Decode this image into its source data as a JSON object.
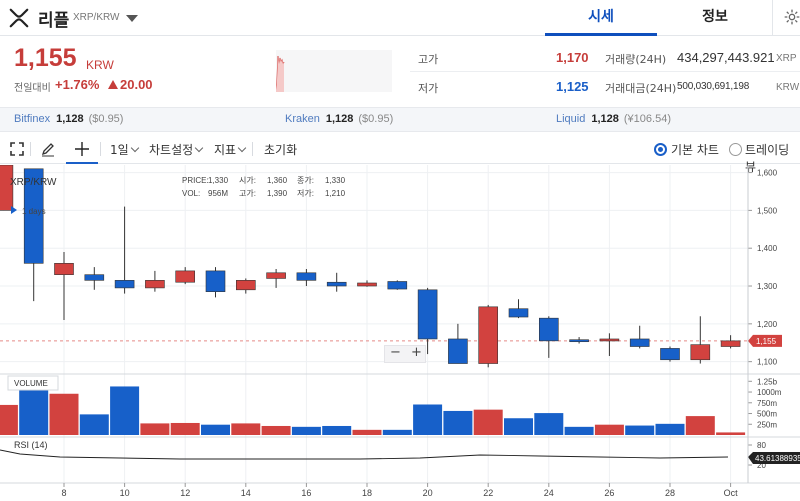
{
  "header": {
    "coin_name": "리플",
    "pair": "XRP/KRW",
    "tabs": [
      {
        "label": "시세",
        "active": true
      },
      {
        "label": "정보",
        "active": false
      }
    ]
  },
  "ticker": {
    "price": "1,155",
    "unit": "KRW",
    "change_label": "전일대비",
    "change_rate": "+1.76%",
    "change_amount": "20.00",
    "high_label": "고가",
    "high": "1,170",
    "low_label": "저가",
    "low": "1,125",
    "volume_label": "거래량(24H)",
    "volume": "434,297,443.921",
    "volume_unit": "XRP",
    "amount_label": "거래대금(24H)",
    "amount": "500,030,691,198",
    "amount_unit": "KRW"
  },
  "exchanges": [
    {
      "name": "Bitfinex",
      "price": "1,128",
      "diff": "($0.95)"
    },
    {
      "name": "Kraken",
      "price": "1,128",
      "diff": "($0.95)"
    },
    {
      "name": "Liquid",
      "price": "1,128",
      "diff": "(¥106.54)"
    }
  ],
  "toolbar": {
    "interval": "1일",
    "chart_settings": "차트설정",
    "indicators": "지표",
    "reset": "초기화",
    "basic_chart": "기본 차트",
    "tradingview": "트레이딩뷰"
  },
  "colors": {
    "up": "#d2423f",
    "down": "#1760c9",
    "accent": "#0f4fbd"
  },
  "chart_data": {
    "type": "candlestick",
    "title": "XRP/KRW",
    "interval_tag": "1 days",
    "ohlc_info": {
      "price_label": "PRICE:",
      "price": "1,330",
      "open_label": "시가:",
      "open": "1,360",
      "close_label": "종가:",
      "close": "1,330",
      "vol_label": "VOL:",
      "vol": "956M",
      "high_label": "고가:",
      "high": "1,390",
      "low_label": "저가:",
      "low": "1,210"
    },
    "price_axis": {
      "min": 1070,
      "max": 1620,
      "ticks": [
        "1,600",
        "1,500",
        "1,400",
        "1,300",
        "1,200",
        "1,100"
      ]
    },
    "current_price": 1155,
    "current_price_label": "1,155",
    "x_ticks": [
      {
        "day": 8,
        "label": "8"
      },
      {
        "day": 10,
        "label": "10"
      },
      {
        "day": 12,
        "label": "12"
      },
      {
        "day": 14,
        "label": "14"
      },
      {
        "day": 16,
        "label": "16"
      },
      {
        "day": 18,
        "label": "18"
      },
      {
        "day": 20,
        "label": "20"
      },
      {
        "day": 22,
        "label": "22"
      },
      {
        "day": 24,
        "label": "24"
      },
      {
        "day": 26,
        "label": "26"
      },
      {
        "day": 28,
        "label": "28"
      },
      {
        "day": 30,
        "label": "Oct"
      }
    ],
    "candles": [
      {
        "day": 6,
        "o": 1500,
        "h": 1625,
        "l": 1500,
        "c": 1620
      },
      {
        "day": 7,
        "o": 1610,
        "h": 1610,
        "l": 1260,
        "c": 1360
      },
      {
        "day": 8,
        "o": 1330,
        "h": 1390,
        "l": 1210,
        "c": 1360
      },
      {
        "day": 9,
        "o": 1330,
        "h": 1350,
        "l": 1290,
        "c": 1315
      },
      {
        "day": 10,
        "o": 1315,
        "h": 1510,
        "l": 1280,
        "c": 1295
      },
      {
        "day": 11,
        "o": 1295,
        "h": 1340,
        "l": 1285,
        "c": 1315
      },
      {
        "day": 12,
        "o": 1310,
        "h": 1350,
        "l": 1305,
        "c": 1340
      },
      {
        "day": 13,
        "o": 1340,
        "h": 1350,
        "l": 1270,
        "c": 1285
      },
      {
        "day": 14,
        "o": 1290,
        "h": 1320,
        "l": 1280,
        "c": 1315
      },
      {
        "day": 15,
        "o": 1320,
        "h": 1345,
        "l": 1295,
        "c": 1335
      },
      {
        "day": 16,
        "o": 1335,
        "h": 1345,
        "l": 1300,
        "c": 1315
      },
      {
        "day": 17,
        "o": 1310,
        "h": 1335,
        "l": 1285,
        "c": 1300
      },
      {
        "day": 18,
        "o": 1300,
        "h": 1315,
        "l": 1298,
        "c": 1308
      },
      {
        "day": 19,
        "o": 1312,
        "h": 1315,
        "l": 1290,
        "c": 1292
      },
      {
        "day": 20,
        "o": 1290,
        "h": 1295,
        "l": 1120,
        "c": 1160
      },
      {
        "day": 21,
        "o": 1160,
        "h": 1200,
        "l": 1095,
        "c": 1095
      },
      {
        "day": 22,
        "o": 1095,
        "h": 1250,
        "l": 1085,
        "c": 1245
      },
      {
        "day": 23,
        "o": 1240,
        "h": 1265,
        "l": 1215,
        "c": 1218
      },
      {
        "day": 24,
        "o": 1215,
        "h": 1220,
        "l": 1110,
        "c": 1155
      },
      {
        "day": 25,
        "o": 1158,
        "h": 1165,
        "l": 1148,
        "c": 1155
      },
      {
        "day": 26,
        "o": 1155,
        "h": 1175,
        "l": 1115,
        "c": 1160
      },
      {
        "day": 27,
        "o": 1160,
        "h": 1195,
        "l": 1135,
        "c": 1140
      },
      {
        "day": 28,
        "o": 1135,
        "h": 1140,
        "l": 1100,
        "c": 1105
      },
      {
        "day": 29,
        "o": 1105,
        "h": 1220,
        "l": 1095,
        "c": 1145
      },
      {
        "day": 30,
        "o": 1140,
        "h": 1170,
        "l": 1135,
        "c": 1155
      }
    ],
    "volume": {
      "label": "VOLUME",
      "max": 1350,
      "ticks": [
        "1.25b",
        "1000m",
        "750m",
        "500m",
        "250m"
      ],
      "values": [
        700,
        1350,
        960,
        480,
        1130,
        270,
        280,
        240,
        270,
        210,
        190,
        210,
        120,
        120,
        710,
        560,
        590,
        390,
        510,
        190,
        240,
        220,
        260,
        440,
        60
      ]
    },
    "rsi": {
      "label": "RSI (14)",
      "value_label": "43.61388935",
      "ticks": [
        "80",
        "20"
      ]
    }
  }
}
